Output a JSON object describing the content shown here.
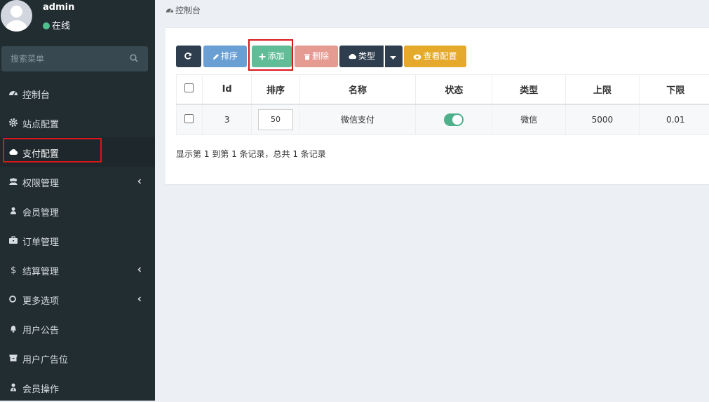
{
  "user": {
    "name": "admin",
    "status": "在线"
  },
  "search": {
    "placeholder": "搜索菜单"
  },
  "menu": [
    {
      "label": "控制台",
      "icon": "dashboard-icon"
    },
    {
      "label": "站点配置",
      "icon": "gear-icon"
    },
    {
      "label": "支付配置",
      "icon": "cloud-icon",
      "active": true
    },
    {
      "label": "权限管理",
      "icon": "users-icon",
      "expandable": true
    },
    {
      "label": "会员管理",
      "icon": "user-icon"
    },
    {
      "label": "订单管理",
      "icon": "briefcase-icon"
    },
    {
      "label": "结算管理",
      "icon": "dollar-icon",
      "expandable": true
    },
    {
      "label": "更多选项",
      "icon": "circle-icon",
      "expandable": true
    },
    {
      "label": "用户公告",
      "icon": "bell-icon"
    },
    {
      "label": "用户广告位",
      "icon": "archive-icon"
    },
    {
      "label": "会员操作",
      "icon": "user-tie-icon"
    }
  ],
  "breadcrumb": {
    "label": "控制台"
  },
  "toolbar": {
    "sort_label": "排序",
    "add_label": "添加",
    "delete_label": "删除",
    "type_label": "类型",
    "view_config_label": "查看配置"
  },
  "table": {
    "headers": {
      "id": "Id",
      "sort": "排序",
      "name": "名称",
      "status": "状态",
      "type": "类型",
      "max": "上限",
      "min": "下限"
    },
    "rows": [
      {
        "id": "3",
        "sort": "50",
        "name": "微信支付",
        "status_on": true,
        "type": "微信",
        "max": "5000",
        "min": "0.01"
      }
    ]
  },
  "pagination": {
    "info": "显示第 1 到第 1 条记录，总共 1 条记录"
  },
  "colors": {
    "sidebar_bg": "#222d32",
    "add_btn": "#60bd98",
    "view_btn": "#e5a92b",
    "highlight_border": "#d9161b"
  }
}
